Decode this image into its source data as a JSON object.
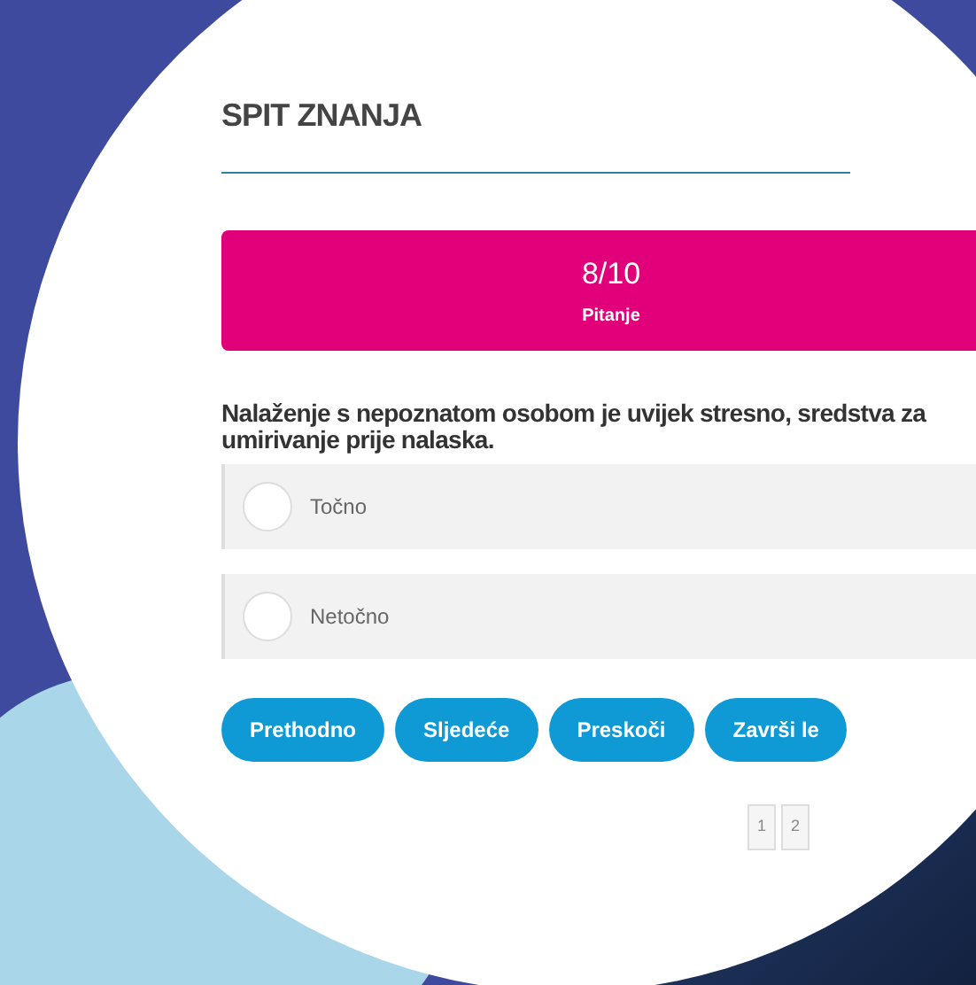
{
  "title": "SPIT ZNANJA",
  "progress": {
    "count": "8/10",
    "label": "Pitanje"
  },
  "question": "Nalaženje s nepoznatom osobom je uvijek stresno, sredstva za umirivanje prije nalaska.",
  "answers": [
    {
      "label": "Točno",
      "selected": false
    },
    {
      "label": "Netočno",
      "selected": false
    }
  ],
  "buttons": [
    "Prethodno",
    "Sljedeće",
    "Preskoči",
    "Završi le"
  ],
  "pages": [
    {
      "label": "1",
      "selected": false
    },
    {
      "label": "2",
      "selected": false
    }
  ]
}
